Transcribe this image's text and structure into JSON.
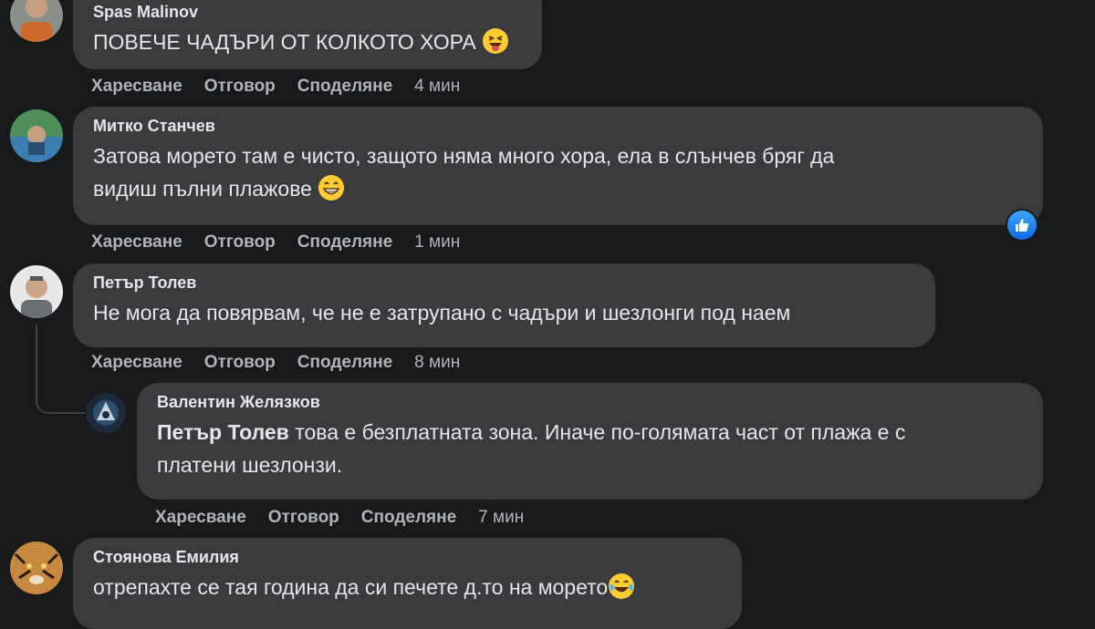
{
  "comments": [
    {
      "author": "Spas Malinov",
      "text": "ПОВЕЧЕ ЧАДЪРИ ОТ КОЛКОТО ХОРА",
      "emoji": "laughing-tongue-emoji",
      "time": "4 мин"
    },
    {
      "author": "Митко Станчев",
      "text_line1": "Затова морето там е чисто, защото няма много хора, ела в слънчев бряг да",
      "text_line2": "видиш пълни плажове",
      "emoji": "grinning-emoji",
      "time": "1 мин",
      "reaction": "like-icon"
    },
    {
      "author": "Петър Толев",
      "text": "Не мога да повярвам, че не е затрупано с чадъри и шезлонги под наем",
      "time": "8 мин"
    },
    {
      "author": "Валентин Желязков",
      "mention": "Петър Толев",
      "text_line1": " това е безплатната зона. Иначе по-голямата част от плажа е с",
      "text_line2": "платени шезлонзи.",
      "time": "7 мин"
    },
    {
      "author": "Стоянова Емилия",
      "text": "отрепахте се тая година да си печете д.то на морето",
      "emoji": "tears-of-joy-emoji"
    }
  ],
  "actions": {
    "like": "Харесване",
    "reply": "Отговор",
    "share": "Споделяне"
  },
  "colors": {
    "background": "#18191a",
    "bubble": "#3a3b3c",
    "text": "#e4e6eb",
    "secondary_text": "#b0b3b8",
    "like_blue": "#1877f2"
  }
}
